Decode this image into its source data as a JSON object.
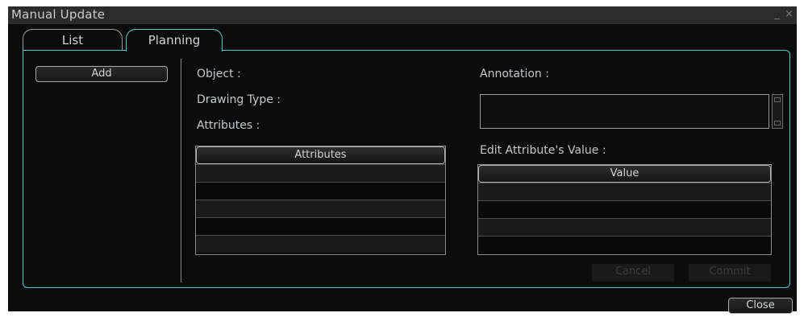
{
  "window": {
    "title": "Manual Update",
    "controls": {
      "minimize": "_",
      "close": "×"
    }
  },
  "tabs": [
    {
      "label": "List",
      "active": false
    },
    {
      "label": "Planning",
      "active": true
    }
  ],
  "left": {
    "add_label": "Add"
  },
  "fields": {
    "object_label": "Object :",
    "drawing_type_label": "Drawing Type :",
    "attributes_label": "Attributes :",
    "annotation_label": "Annotation :",
    "edit_value_label": "Edit Attribute's Value :"
  },
  "attributes_table": {
    "header": "Attributes",
    "rows": [
      "",
      "",
      "",
      "",
      ""
    ]
  },
  "value_table": {
    "header": "Value",
    "rows": [
      "",
      "",
      "",
      ""
    ]
  },
  "actions": {
    "cancel": "Cancel",
    "commit": "Commit",
    "close": "Close"
  },
  "colors": {
    "accent": "#52c6cf",
    "background": "#0c0c0c",
    "titlebar": "#2b2b2b"
  }
}
